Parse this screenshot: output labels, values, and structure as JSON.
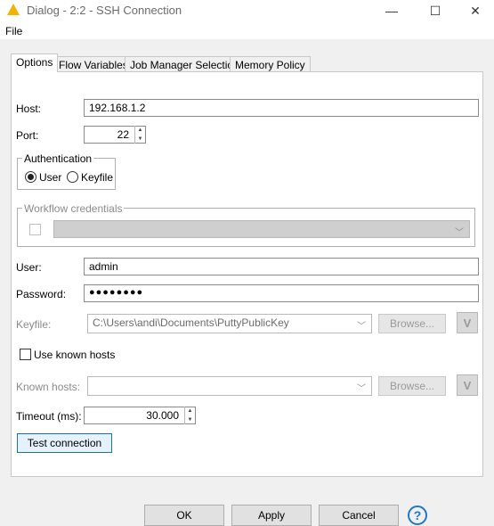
{
  "window": {
    "title": "Dialog - 2:2 - SSH Connection",
    "minimize": "—",
    "maximize": "☐",
    "close": "✕"
  },
  "menu": {
    "file": "File"
  },
  "tabs": [
    {
      "label": "Options",
      "active": true
    },
    {
      "label": "Flow Variables",
      "active": false
    },
    {
      "label": "Job Manager Selection",
      "active": false
    },
    {
      "label": "Memory Policy",
      "active": false
    }
  ],
  "form": {
    "host_label": "Host:",
    "host_value": "192.168.1.2",
    "port_label": "Port:",
    "port_value": "22",
    "auth_legend": "Authentication",
    "auth_user": "User",
    "auth_keyfile": "Keyfile",
    "auth_selected": "User",
    "workflow_legend": "Workflow credentials",
    "user_label": "User:",
    "user_value": "admin",
    "password_label": "Password:",
    "password_value": "●●●●●●●●",
    "keyfile_label": "Keyfile:",
    "keyfile_value": "C:\\Users\\andi\\Documents\\PuttyPublicKey",
    "browse_label": "Browse...",
    "use_known_hosts_label": "Use known hosts",
    "known_hosts_label": "Known hosts:",
    "known_hosts_value": "",
    "timeout_label": "Timeout (ms):",
    "timeout_value": "30.000",
    "test_connection": "Test connection",
    "v_label": "V"
  },
  "footer": {
    "ok": "OK",
    "apply": "Apply",
    "cancel": "Cancel",
    "help": "?"
  },
  "colors": {
    "accent": "#1e6fb5",
    "warning_icon": "#f2b400"
  }
}
